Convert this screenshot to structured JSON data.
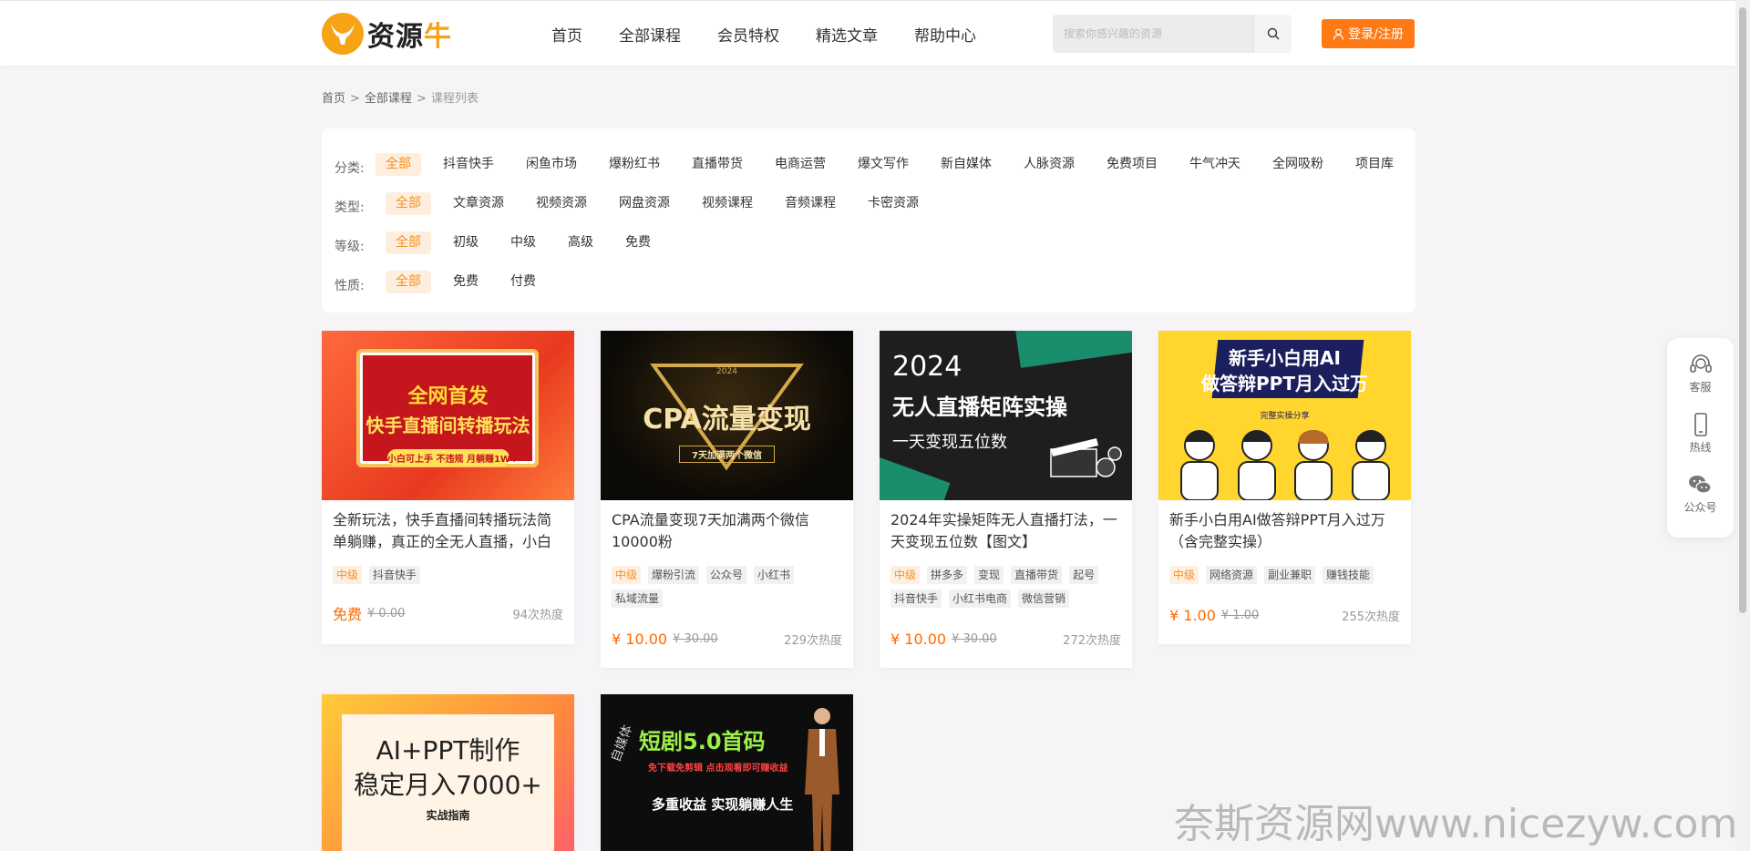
{
  "header": {
    "logo_text_a": "资源",
    "logo_text_b": "牛",
    "nav": [
      "首页",
      "全部课程",
      "会员特权",
      "精选文章",
      "帮助中心"
    ],
    "search_placeholder": "搜索你感兴趣的资源",
    "login_label": "登录/注册"
  },
  "breadcrumb": {
    "home": "首页",
    "courses": "全部课程",
    "current": "课程列表",
    "separator": ">"
  },
  "filters": [
    {
      "label": "分类:",
      "options": [
        "全部",
        "抖音快手",
        "闲鱼市场",
        "爆粉红书",
        "直播带货",
        "电商运营",
        "爆文写作",
        "新自媒体",
        "人脉资源",
        "免费项目",
        "牛气冲天",
        "全网吸粉",
        "项目库"
      ]
    },
    {
      "label": "类型:",
      "options": [
        "全部",
        "文章资源",
        "视频资源",
        "网盘资源",
        "视频课程",
        "音频课程",
        "卡密资源"
      ]
    },
    {
      "label": "等级:",
      "options": [
        "全部",
        "初级",
        "中级",
        "高级",
        "免费"
      ]
    },
    {
      "label": "性质:",
      "options": [
        "全部",
        "免费",
        "付费"
      ]
    }
  ],
  "cards": [
    {
      "title": "全新玩法，快手直播间转播玩法简单躺赚，真正的全无人直播，小白",
      "thumb_text": [
        "全网首发",
        "快手直播间转播玩法",
        "小白可上手 不违规 月躺赚1W+"
      ],
      "level": "中级",
      "tags": [
        "抖音快手"
      ],
      "price": "免费",
      "original_price": "¥ 0.00",
      "heat": "94次热度"
    },
    {
      "title": "CPA流量变现7天加满两个微信10000粉",
      "thumb_text": [
        "2024",
        "CPA流量变现",
        "7天加满两个微信"
      ],
      "level": "中级",
      "tags": [
        "爆粉引流",
        "公众号",
        "小红书",
        "私域流量"
      ],
      "price": "¥ 10.00",
      "original_price": "¥ 30.00",
      "heat": "229次热度"
    },
    {
      "title": "2024年实操矩阵无人直播打法，一天变现五位数【图文】",
      "thumb_text": [
        "2024",
        "无人直播矩阵实操",
        "一天变现五位数"
      ],
      "level": "中级",
      "tags": [
        "拼多多",
        "变现",
        "直播带货",
        "起号",
        "抖音快手",
        "小红书电商",
        "微信营销"
      ],
      "price": "¥ 10.00",
      "original_price": "¥ 30.00",
      "heat": "272次热度"
    },
    {
      "title": "新手小白用AI做答辩PPT月入过万（含完整实操）",
      "thumb_text": [
        "新手小白用AI",
        "做答辩PPT月入过万",
        "完整实操分享"
      ],
      "level": "中级",
      "tags": [
        "网络资源",
        "副业兼职",
        "赚钱技能"
      ],
      "price": "¥ 1.00",
      "original_price": "¥ 1.00",
      "heat": "255次热度"
    },
    {
      "thumb_text": [
        "AI+PPT制作",
        "稳定月入7000+",
        "实战指南"
      ]
    },
    {
      "thumb_text": [
        "短剧5.0首码",
        "免下载免剪辑 点击观看即可赚收益",
        "多重收益 实现躺赚人生",
        "自媒体"
      ]
    }
  ],
  "side": [
    "客服",
    "热线",
    "公众号"
  ],
  "watermark": "奈斯资源网www.nicezyw.com",
  "colors": {
    "accent": "#ff7a14",
    "active_bg": "#fdeedd",
    "price": "#ff6a00",
    "logo": "#f6a316"
  }
}
